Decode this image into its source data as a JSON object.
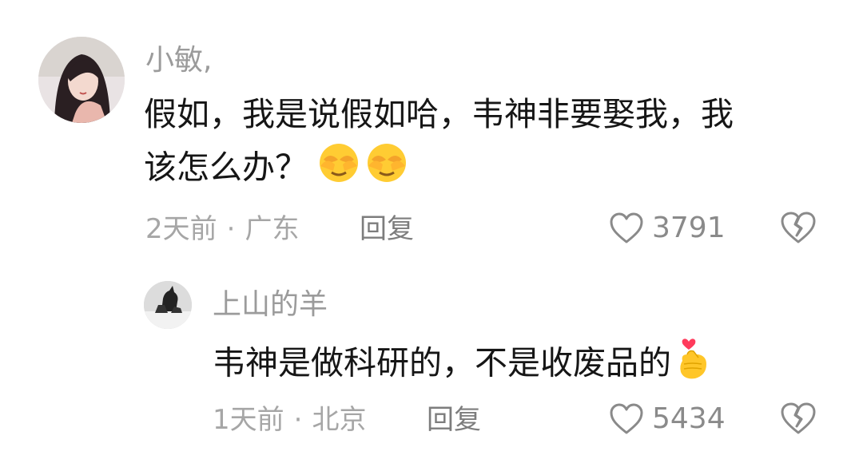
{
  "comments": [
    {
      "author": "小敏,",
      "text_lines": [
        "假如，我是说假如哈，韦神非要娶我，我",
        "该怎么办？"
      ],
      "emoji": [
        "face-with-hands-icon",
        "face-with-hands-icon"
      ],
      "time": "2天前",
      "separator": "·",
      "location": "广东",
      "reply_label": "回复",
      "likes": "3791"
    },
    {
      "author": "上山的羊",
      "text_lines": [
        "韦神是做科研的，不是收废品的"
      ],
      "emoji": [
        "finger-heart-icon"
      ],
      "time": "1天前",
      "separator": "·",
      "location": "北京",
      "reply_label": "回复",
      "likes": "5434"
    }
  ],
  "colors": {
    "text": "#161616",
    "author": "#9b9b9b",
    "meta": "#a6a6a6",
    "icon": "#8a8a8a",
    "emoji_yellow": "#ffcc33",
    "heart_red": "#ff3b5c"
  }
}
